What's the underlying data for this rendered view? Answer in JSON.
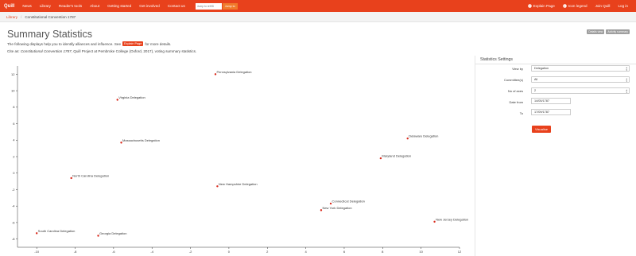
{
  "nav": {
    "brand": "Quill",
    "items": [
      "News",
      "Library",
      "Reader's tools",
      "About",
      "Getting started",
      "Get involved",
      "Contact us"
    ],
    "jump_placeholder": "Jump to ref/ID",
    "jump_button": "Jump to",
    "right": {
      "explain": "Explain Page",
      "icon_legend": "Icon legend",
      "join": "Join Quill",
      "login": "Log in"
    }
  },
  "breadcrumb": {
    "library": "Library",
    "current": "Constitutional Convention 1787"
  },
  "page": {
    "title": "Summary Statistics",
    "desc_before": "The following displays help you to identify alliances and influence. See",
    "explain_label": "Explain Page",
    "desc_after": "for more details.",
    "cite_prefix": "Cite as:",
    "cite_title": "Constitutional Convention 1787",
    "cite_rest": ", Quill Project at Pembroke College (Oxford, 2017), voting summary statistics.",
    "buttons": {
      "details": "Details view",
      "activity": "Activity summary"
    }
  },
  "settings": {
    "heading": "Statistics Settings",
    "view_by_label": "View by",
    "view_by_value": "Delegation",
    "committees_label": "Committee(s)",
    "committees_value": "All",
    "axes_label": "No of axes",
    "axes_value": "2",
    "date_from_label": "Date from",
    "date_from_value": "14/05/1787",
    "to_label": "To",
    "to_value": "17/09/1787",
    "visualise_label": "Visualise"
  },
  "chart_data": {
    "type": "scatter",
    "xlim": [
      -11,
      12
    ],
    "ylim": [
      -9,
      13
    ],
    "x_ticks": [
      -10,
      -8,
      -6,
      -4,
      -2,
      0,
      2,
      4,
      6,
      8,
      10,
      12
    ],
    "y_ticks": [
      -8,
      -6,
      -4,
      -2,
      0,
      2,
      4,
      6,
      8,
      10,
      12
    ],
    "points_color": "#d9281a",
    "points": [
      {
        "label": "Pennsylvania Delegation",
        "x": -0.7,
        "y": 12.0
      },
      {
        "label": "Virginia Delegation",
        "x": -5.8,
        "y": 8.9
      },
      {
        "label": "Massachusetts Delegation",
        "x": -5.6,
        "y": 3.7
      },
      {
        "label": "Delaware Delegation",
        "x": 9.3,
        "y": 4.2
      },
      {
        "label": "Maryland Delegation",
        "x": 7.9,
        "y": 1.8
      },
      {
        "label": "North Carolina Delegation",
        "x": -8.2,
        "y": -0.6
      },
      {
        "label": "New Hampshire Delegation",
        "x": -0.6,
        "y": -1.6
      },
      {
        "label": "Connecticut Delegation",
        "x": 5.3,
        "y": -3.7
      },
      {
        "label": "New York Delegation",
        "x": 4.8,
        "y": -4.5
      },
      {
        "label": "New Jersey Delegation",
        "x": 10.7,
        "y": -5.9
      },
      {
        "label": "South Carolina Delegation",
        "x": -10.0,
        "y": -7.3
      },
      {
        "label": "Georgia Delegation",
        "x": -6.8,
        "y": -7.6
      }
    ]
  }
}
